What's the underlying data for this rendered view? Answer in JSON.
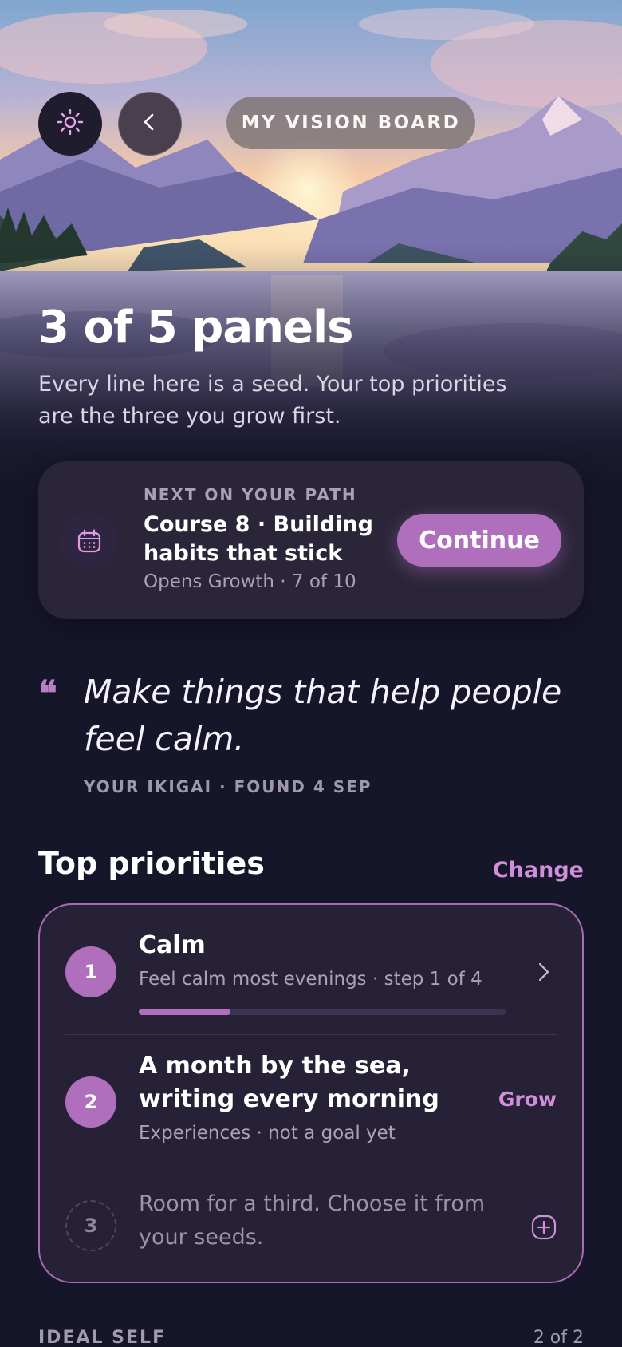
{
  "header": {
    "title": "MY VISION BOARD",
    "theme_icon": "sun-icon",
    "back_icon": "chevron-left-icon"
  },
  "hero": {
    "title": "3 of 5 panels",
    "subtitle": "Every line here is a seed. Your top priorities are the three you grow first."
  },
  "next_card": {
    "icon": "calendar-icon",
    "eyebrow": "NEXT ON YOUR PATH",
    "title": "Course 8 · Building habits that stick",
    "meta": "Opens Growth · 7 of 10",
    "button_label": "Continue"
  },
  "quote": {
    "mark": "❝",
    "text": "Make things that help people feel calm.",
    "meta": "YOUR IKIGAI · FOUND 4 SEP"
  },
  "priorities": {
    "title": "Top priorities",
    "change_label": "Change",
    "items": [
      {
        "number": "1",
        "title": "Calm",
        "subtitle": "Feel calm most evenings · step 1 of 4",
        "progress": 0.25
      },
      {
        "number": "2",
        "title": "A month by the sea, writing every morning",
        "subtitle": "Experiences · not a goal yet",
        "action": "Grow"
      },
      {
        "number": "3",
        "text": "Room for a third. Choose it from your seeds."
      }
    ]
  },
  "ideal_self": {
    "label": "IDEAL SELF",
    "count": "2 of 2"
  },
  "colors": {
    "background": "#16162a",
    "accent": "#b06fbd",
    "accent_link": "#d08fd8",
    "card": "#2a2538"
  }
}
